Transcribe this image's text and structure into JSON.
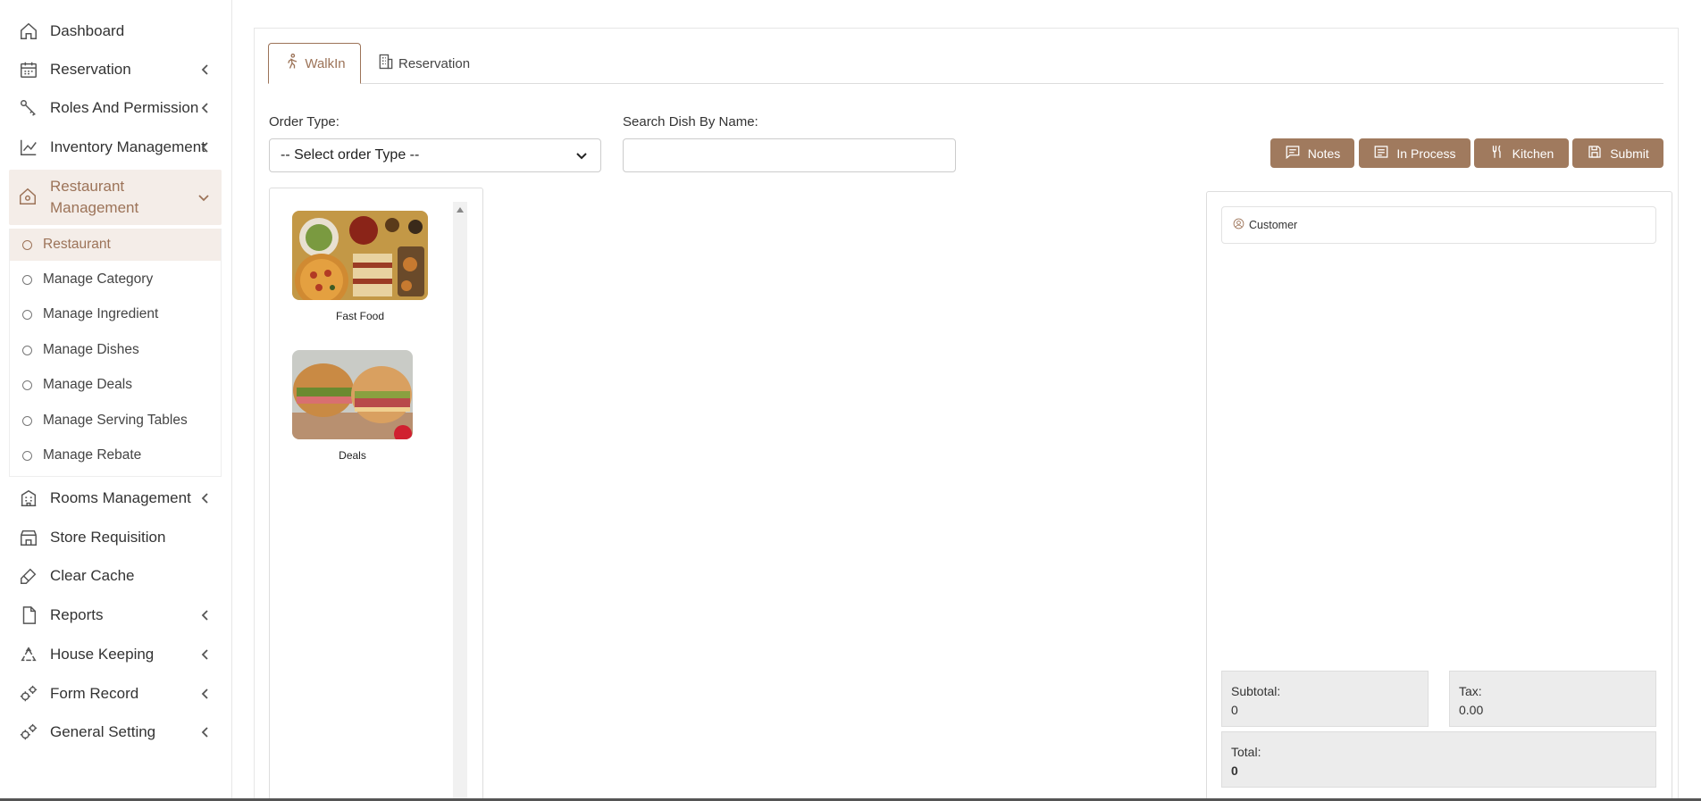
{
  "sidebar": {
    "items": [
      {
        "label": "Dashboard",
        "icon": "home-icon",
        "chevron": false
      },
      {
        "label": "Reservation",
        "icon": "calendar-icon",
        "chevron": true
      },
      {
        "label": "Roles And Permission",
        "icon": "key-icon",
        "chevron": true
      },
      {
        "label": "Inventory Management",
        "icon": "chart-line-icon",
        "chevron": true
      },
      {
        "label": "Restaurant Management",
        "icon": "house-icon",
        "chevron": true,
        "expanded": true
      },
      {
        "label": "Rooms Management",
        "icon": "building-icon",
        "chevron": true
      },
      {
        "label": "Store Requisition",
        "icon": "store-icon",
        "chevron": false
      },
      {
        "label": "Clear Cache",
        "icon": "brush-icon",
        "chevron": false
      },
      {
        "label": "Reports",
        "icon": "file-icon",
        "chevron": true
      },
      {
        "label": "House Keeping",
        "icon": "recycle-icon",
        "chevron": true
      },
      {
        "label": "Form Record",
        "icon": "gears-icon",
        "chevron": true
      },
      {
        "label": "General Setting",
        "icon": "gears-icon",
        "chevron": true
      }
    ],
    "submenu": [
      {
        "label": "Restaurant",
        "active": true
      },
      {
        "label": "Manage Category"
      },
      {
        "label": "Manage Ingredient"
      },
      {
        "label": "Manage Dishes"
      },
      {
        "label": "Manage Deals"
      },
      {
        "label": "Manage Serving Tables"
      },
      {
        "label": "Manage Rebate"
      }
    ]
  },
  "tabs": [
    {
      "label": "WalkIn",
      "icon": "walking-icon",
      "active": true
    },
    {
      "label": "Reservation",
      "icon": "building-icon"
    }
  ],
  "form": {
    "order_type_label": "Order Type:",
    "order_type_value": "-- Select order Type --",
    "search_label": "Search Dish By Name:",
    "search_value": "",
    "search_placeholder": ""
  },
  "buttons": {
    "notes": "Notes",
    "in_process": "In Process",
    "kitchen": "Kitchen",
    "submit": "Submit"
  },
  "categories": [
    {
      "name": "Fast Food"
    },
    {
      "name": "Deals"
    }
  ],
  "order": {
    "customer_label": "Customer",
    "subtotal_label": "Subtotal:",
    "subtotal_value": "0",
    "tax_label": "Tax:",
    "tax_value": "0.00",
    "total_label": "Total:",
    "total_value": "0"
  },
  "colors": {
    "accent": "#a07a5e",
    "active_bg": "#f4ede8"
  }
}
